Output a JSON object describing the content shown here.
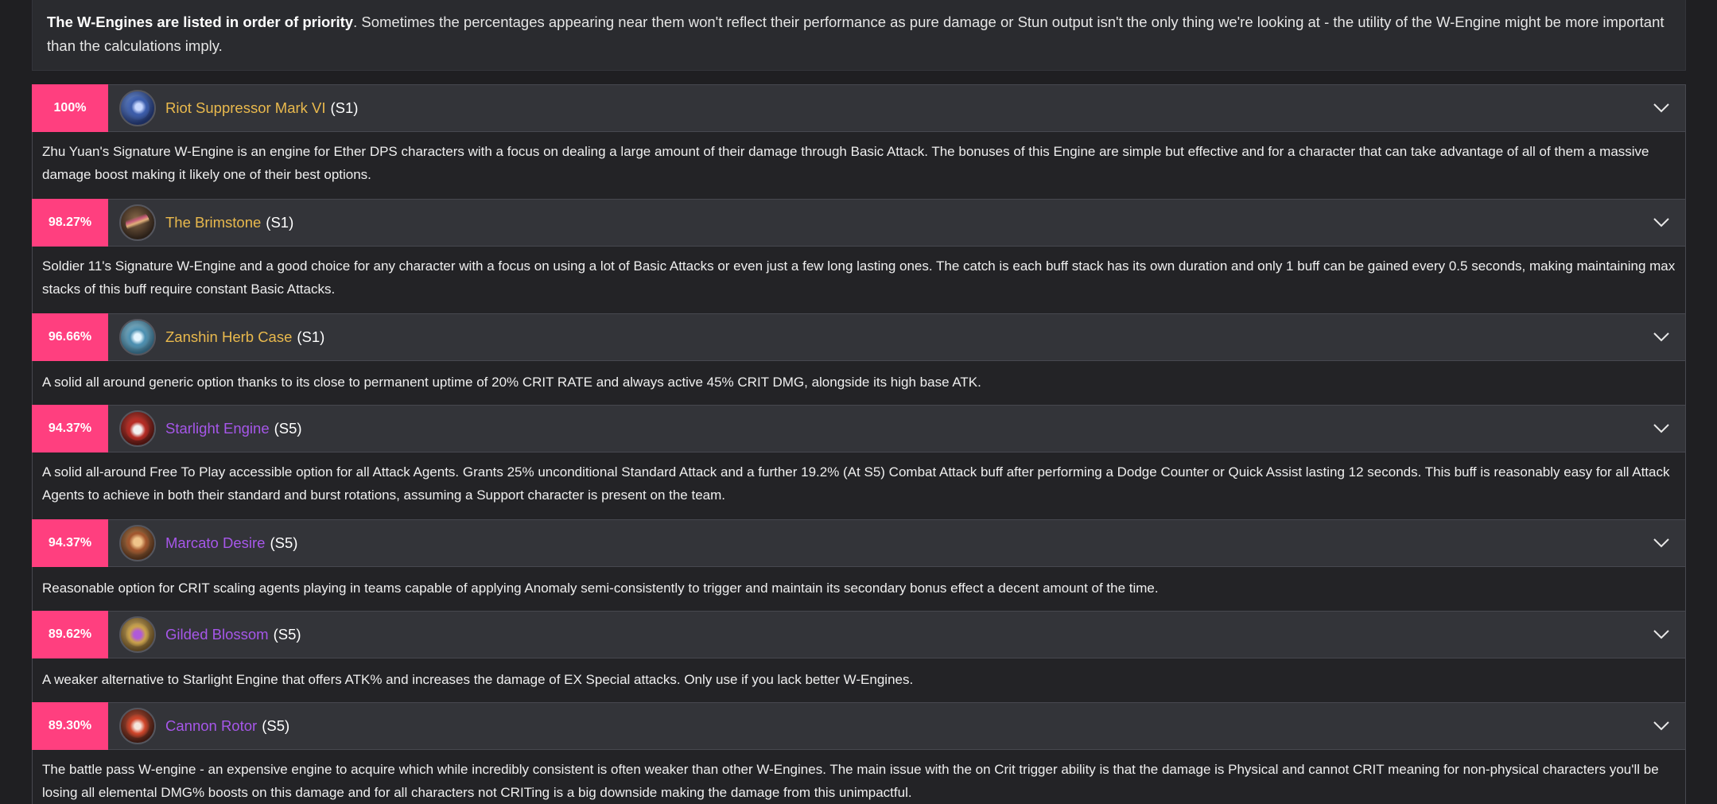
{
  "intro": {
    "bold": "The W-Engines are listed in order of priority",
    "text": ". Sometimes the percentages appearing near them won't reflect their performance as pure damage or Stun output isn't the only thing we're looking at - the utility of the W-Engine might be more important than the calculations imply."
  },
  "engines": [
    {
      "percent": "100%",
      "name": "Riot Suppressor Mark VI",
      "rank": "(S1)",
      "rarity_color": "#e9b94d",
      "icon": "riot-suppressor-icon",
      "description": "Zhu Yuan's Signature W-Engine is an engine for Ether DPS characters with a focus on dealing a large amount of their damage through Basic Attack. The bonuses of this Engine are simple but effective and for a character that can take advantage of all of them a massive damage boost making it likely one of their best options."
    },
    {
      "percent": "98.27%",
      "name": "The Brimstone",
      "rank": "(S1)",
      "rarity_color": "#e9b94d",
      "icon": "brimstone-icon",
      "description": "Soldier 11's Signature W-Engine and a good choice for any character with a focus on using a lot of Basic Attacks or even just a few long lasting ones. The catch is each buff stack has its own duration and only 1 buff can be gained every 0.5 seconds, making maintaining max stacks of this buff require constant Basic Attacks."
    },
    {
      "percent": "96.66%",
      "name": "Zanshin Herb Case",
      "rank": "(S1)",
      "rarity_color": "#e9b94d",
      "icon": "zanshin-herb-case-icon",
      "description": "A solid all around generic option thanks to its close to permanent uptime of 20% CRIT RATE and always active 45% CRIT DMG, alongside its high base ATK."
    },
    {
      "percent": "94.37%",
      "name": "Starlight Engine",
      "rank": "(S5)",
      "rarity_color": "#a657e9",
      "icon": "starlight-engine-icon",
      "description": "A solid all-around Free To Play accessible option for all Attack Agents. Grants 25% unconditional Standard Attack and a further 19.2% (At S5) Combat Attack buff after performing a Dodge Counter or Quick Assist lasting 12 seconds. This buff is reasonably easy for all Attack Agents to achieve in both their standard and burst rotations, assuming a Support character is present on the team."
    },
    {
      "percent": "94.37%",
      "name": "Marcato Desire",
      "rank": "(S5)",
      "rarity_color": "#a657e9",
      "icon": "marcato-desire-icon",
      "description": "Reasonable option for CRIT scaling agents playing in teams capable of applying Anomaly semi-consistently to trigger and maintain its secondary bonus effect a decent amount of the time."
    },
    {
      "percent": "89.62%",
      "name": "Gilded Blossom",
      "rank": "(S5)",
      "rarity_color": "#a657e9",
      "icon": "gilded-blossom-icon",
      "description": "A weaker alternative to Starlight Engine that offers ATK% and increases the damage of EX Special attacks. Only use if you lack better W-Engines."
    },
    {
      "percent": "89.30%",
      "name": "Cannon Rotor",
      "rank": "(S5)",
      "rarity_color": "#a657e9",
      "icon": "cannon-rotor-icon",
      "description": "The battle pass W-engine - an expensive engine to acquire which while incredibly consistent is often weaker than other W-Engines. The main issue with the on Crit trigger ability is that the damage is Physical and cannot CRIT meaning for non-physical characters you'll be losing all elemental DMG% boosts on this damage and for all characters not CRITing is a big downside making the damage from this unimpactful."
    }
  ],
  "colors": {
    "percent_badge": "#ff3f7f",
    "gold": "#e9b94d",
    "purple": "#a657e9"
  }
}
